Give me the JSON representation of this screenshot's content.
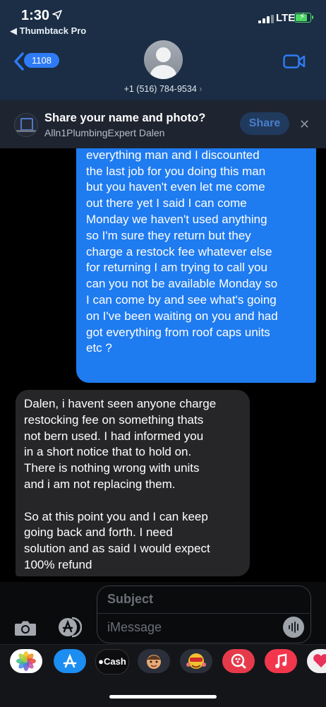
{
  "status_bar": {
    "time": "1:30",
    "back_app": "◀ Thumbtack Pro",
    "network": "LTE"
  },
  "header": {
    "unread_count": "1108",
    "phone_number": "+1 (516) 784-9534",
    "phone_chevron": "›"
  },
  "share_banner": {
    "title": "Share your name and photo?",
    "subtitle": "Alln1PlumbingExpert Dalen",
    "share_label": "Share",
    "close_label": "✕"
  },
  "messages": [
    {
      "direction": "outgoing",
      "text": "that I will have to go return\neverything man and I discounted\nthe last job for you doing this man\nbut you haven't even let me come\nout there yet I said I can come\nMonday we haven't used anything\nso I'm sure they return but they\ncharge a restock fee whatever else\nfor returning I am trying to call you\ncan you not be available Monday so\nI can come by and see what's going\non I've been waiting on you and had\ngot everything from roof caps units\netc ?"
    },
    {
      "direction": "incoming",
      "text": "Dalen, i havent seen anyone charge\nrestocking fee on something thats\nnot bern used. I had informed you\nin a short notice that to hold on.\nThere is nothing wrong with units\nand i am not replacing them.\n\nSo at this point you and I can keep\ngoing back and forth. I need\nsolution and as said I would expect\n100% refund"
    }
  ],
  "composer": {
    "subject_placeholder": "Subject",
    "message_placeholder": "iMessage"
  },
  "app_drawer": {
    "apps": [
      {
        "icon": "photos-icon",
        "label": ""
      },
      {
        "icon": "app-store-icon",
        "label": ""
      },
      {
        "icon": "apple-cash-icon",
        "label": "Cash"
      },
      {
        "icon": "memoji-icon",
        "label": ""
      },
      {
        "icon": "memoji-stickers-icon",
        "label": ""
      },
      {
        "icon": "search-images-icon",
        "label": ""
      },
      {
        "icon": "music-icon",
        "label": ""
      },
      {
        "icon": "heart-app-icon",
        "label": ""
      }
    ]
  },
  "colors": {
    "outgoing_bubble": "#1f7bf0",
    "incoming_bubble": "#262628",
    "header_bg": "#1a2d44",
    "accent": "#2f7bf5"
  }
}
